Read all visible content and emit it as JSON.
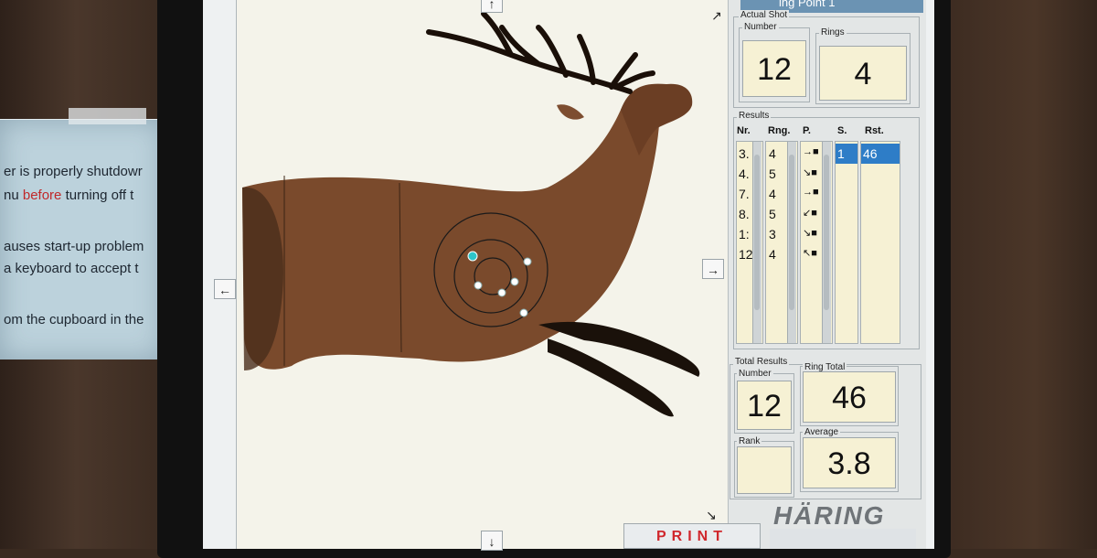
{
  "notice": {
    "lines": [
      {
        "text": "er is properly shutdowr"
      },
      {
        "pre": "nu ",
        "red": "before",
        "post": " turning off t"
      },
      {
        "text": "auses start-up problem"
      },
      {
        "text": "a keyboard to accept t"
      },
      {
        "text": "om the cupboard in the"
      }
    ]
  },
  "top_label": "...",
  "header_title": "ing Point 1",
  "nav": {
    "left": "←",
    "right": "→",
    "top": "↑",
    "bottom": "↓",
    "corner_ne": "↗",
    "corner_se": "↘"
  },
  "actual_shot": {
    "title": "Actual Shot",
    "number_label": "Number",
    "number": "12",
    "rings_label": "Rings",
    "rings": "4"
  },
  "results": {
    "title": "Results",
    "headers": {
      "nr": "Nr.",
      "rng": "Rng.",
      "p": "P.",
      "s": "S.",
      "rst": "Rst."
    },
    "nr": [
      "3.",
      "4.",
      "7.",
      "8.",
      "1:",
      "12"
    ],
    "rng": [
      "4",
      "5",
      "4",
      "5",
      "3",
      "4"
    ],
    "p": [
      "→■",
      "↘■",
      "→■",
      "↙■",
      "↘■",
      "↖■"
    ],
    "s": [
      "1"
    ],
    "rst": [
      "46"
    ]
  },
  "total_results": {
    "title": "Total Results",
    "number_label": "Number",
    "number": "12",
    "ring_total_label": "Ring Total",
    "ring_total": "46",
    "rank_label": "Rank",
    "rank": "",
    "average_label": "Average",
    "average": "3.8"
  },
  "print_label": "PRINT",
  "logo_text": "HÄRING",
  "colors": {
    "deer": "#7a4a2c",
    "panel_bg": "#e3e6e6",
    "value_bg": "#f6f1d4",
    "selection": "#2e7dc7",
    "shot": "#ffffff",
    "last_shot": "#2ec4c8",
    "print_red": "#d0272c"
  }
}
